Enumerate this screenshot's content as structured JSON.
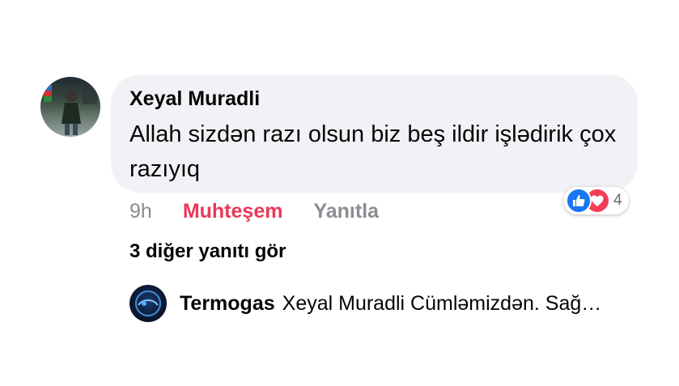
{
  "comment": {
    "author": "Xeyal Muradli",
    "text": "Allah sizdən razı olsun biz beş ildir işlədirik çox razıyıq",
    "time": "9h",
    "reaction_label": "Muhteşem",
    "reply_label": "Yanıtla",
    "reactions": {
      "types": [
        "like-icon",
        "love-icon"
      ],
      "count": "4",
      "colors": {
        "like": "#1877f2",
        "love": "#f33e58"
      }
    }
  },
  "more_replies": "3 diğer yanıtı gör",
  "latest_reply": {
    "author": "Termogas",
    "snippet": "Xeyal Muradli Cümləmizdən. Sağ…"
  },
  "colors": {
    "bubble": "#f0f2f5",
    "muted": "#8a8d91",
    "reaction_active": "#e8395a"
  }
}
